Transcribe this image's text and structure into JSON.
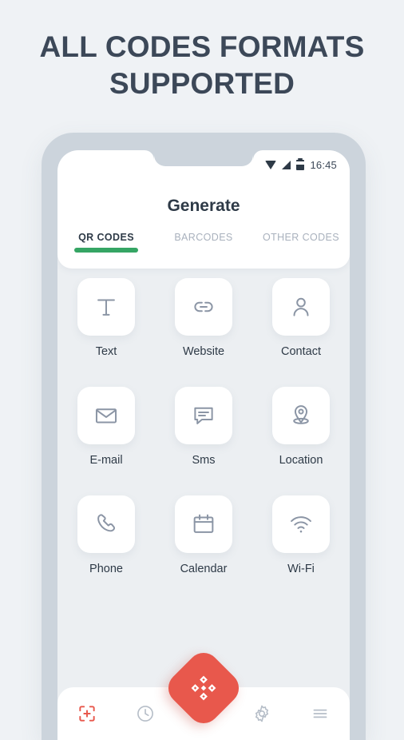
{
  "headline": "ALL CODES FORMATS SUPPORTED",
  "colors": {
    "page_background": "#eff2f5",
    "headline_text": "#3c4858",
    "phone_frame": "#ccd4dc",
    "screen_background": "#eceff2",
    "card": "#ffffff",
    "accent_green": "#35a564",
    "accent_red": "#e8584c",
    "icon_gray": "#8b95a5",
    "label_text": "#2e3a47",
    "tab_inactive": "#a9b1bd"
  },
  "phone": {
    "status_bar": {
      "wifi_icon": "wifi-icon",
      "signal_icon": "signal-icon",
      "battery_icon": "battery-icon",
      "time": "16:45"
    },
    "screen_title": "Generate",
    "tabs": [
      {
        "label": "QR CODES",
        "active": true
      },
      {
        "label": "BARCODES",
        "active": false
      },
      {
        "label": "OTHER CODES",
        "active": false
      }
    ],
    "grid": [
      {
        "label": "Text",
        "icon": "text-t-icon"
      },
      {
        "label": "Website",
        "icon": "link-icon"
      },
      {
        "label": "Contact",
        "icon": "person-icon"
      },
      {
        "label": "E-mail",
        "icon": "envelope-icon"
      },
      {
        "label": "Sms",
        "icon": "chat-bubble-icon"
      },
      {
        "label": "Location",
        "icon": "map-pin-icon"
      },
      {
        "label": "Phone",
        "icon": "phone-handset-icon"
      },
      {
        "label": "Calendar",
        "icon": "calendar-icon"
      },
      {
        "label": "Wi-Fi",
        "icon": "wifi-signal-icon"
      }
    ],
    "bottom_nav": [
      {
        "name": "scan-icon",
        "active": true
      },
      {
        "name": "history-clock-icon",
        "active": false
      },
      {
        "name": "settings-gear-icon",
        "active": false
      },
      {
        "name": "menu-hamburger-icon",
        "active": false
      }
    ],
    "fab": {
      "icon": "qr-diamond-icon"
    }
  }
}
